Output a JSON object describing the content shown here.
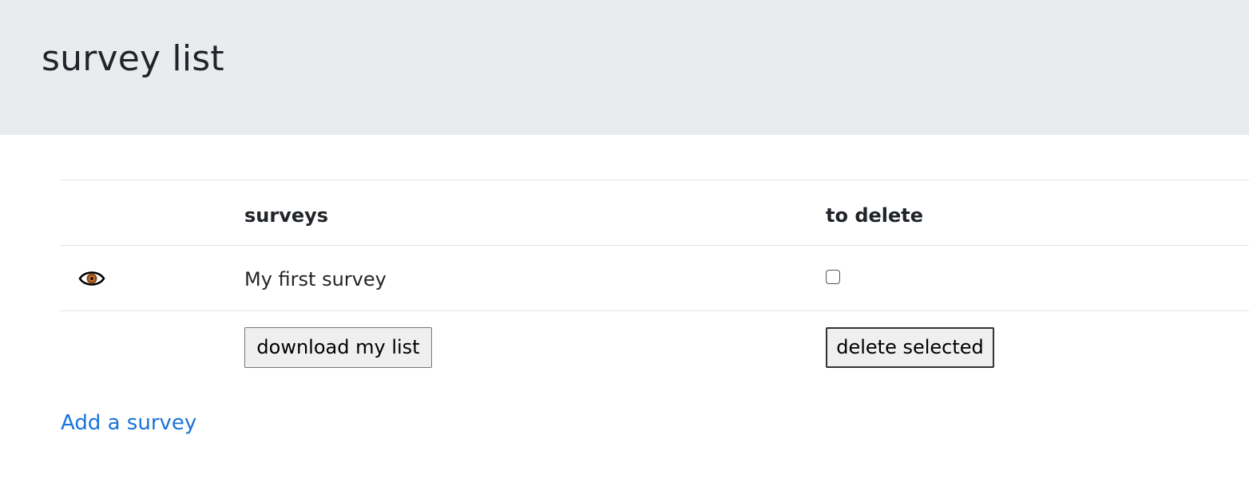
{
  "header": {
    "title": "survey list"
  },
  "table": {
    "columns": [
      "",
      "surveys",
      "to delete"
    ],
    "rows": [
      {
        "icon": "eye-icon",
        "name": "My first survey",
        "to_delete": false
      }
    ]
  },
  "actions": {
    "download_label": "download my list",
    "delete_label": "delete selected"
  },
  "links": {
    "add_survey": "Add a survey"
  },
  "colors": {
    "header_bg": "#e9ecef",
    "link": "#1a73d9",
    "rule": "#dee2e6"
  }
}
